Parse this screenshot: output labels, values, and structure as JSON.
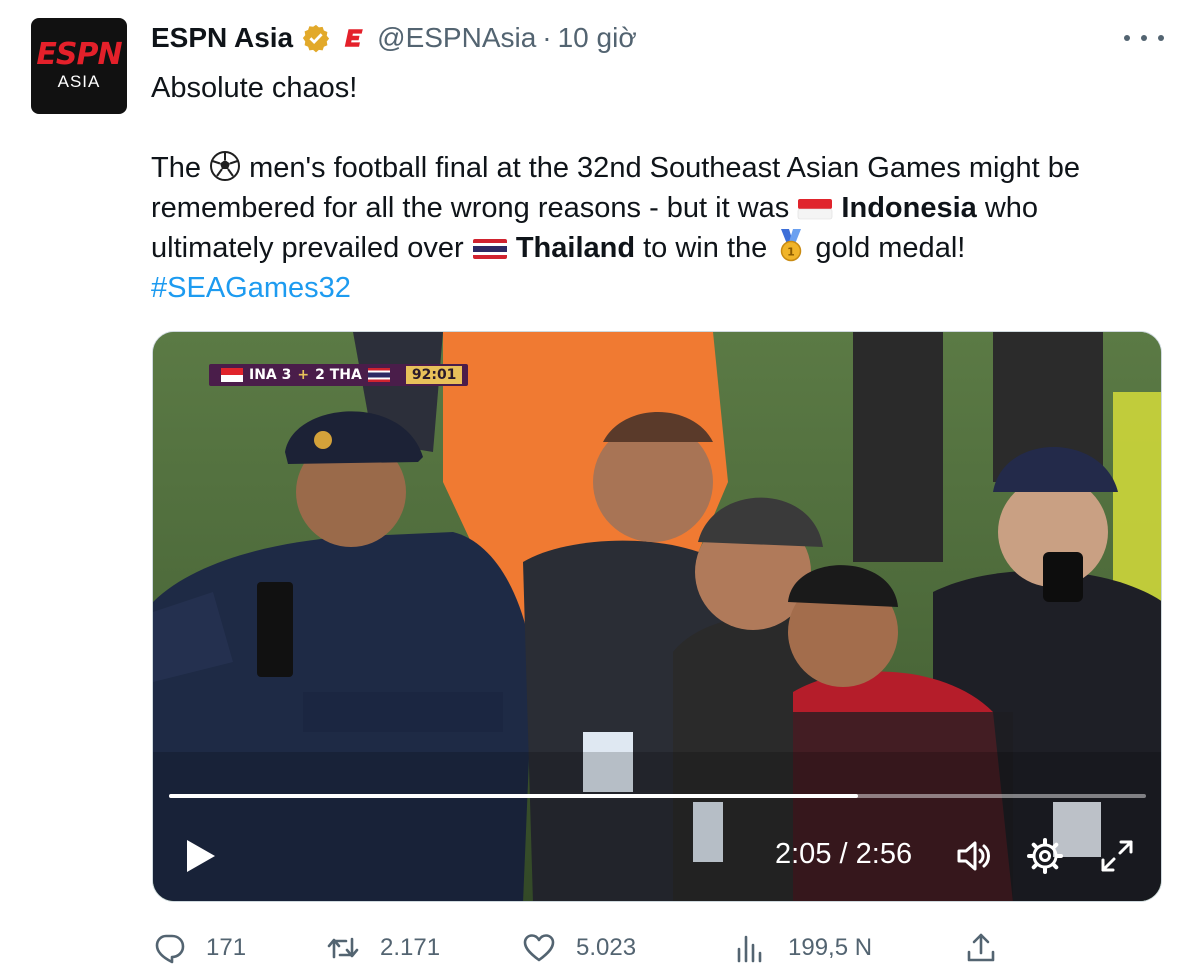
{
  "author": {
    "avatar_brand": "ESPN",
    "avatar_sub": "ASIA",
    "name": "ESPN Asia",
    "handle": "@ESPNAsia",
    "time": "10 giờ",
    "verified_color": "#e2a92a",
    "affiliate_icon": "espn-e-icon"
  },
  "tweet": {
    "line1": "Absolute chaos!",
    "p2_a": "The",
    "p2_b": "men's football final at the 32nd Southeast Asian Games might be remembered for all the wrong reasons - but it was",
    "country1": "Indonesia",
    "p2_c": "who ultimately prevailed over",
    "country2": "Thailand",
    "p2_d": "to win the",
    "p2_e": "gold medal!",
    "hashtag": "#SEAGames32",
    "emojis": [
      "soccer-ball",
      "indonesia-flag",
      "thailand-flag",
      "gold-medal"
    ]
  },
  "video": {
    "scorebug": {
      "team1": "INA",
      "score1": "3",
      "score2": "2",
      "team2": "THA",
      "clock": "92:01"
    },
    "progress": 0.705,
    "current_time": "2:05",
    "duration": "2:56",
    "separator": "/",
    "controls": [
      "play-icon",
      "volume-icon",
      "settings-icon",
      "fullscreen-icon"
    ]
  },
  "actions": {
    "replies": "171",
    "retweets": "2.171",
    "likes": "5.023",
    "views": "199,5 N",
    "icons": [
      "reply-icon",
      "retweet-icon",
      "like-icon",
      "views-icon",
      "share-icon"
    ]
  },
  "colors": {
    "accent": "#1d9bf0",
    "muted": "#536471",
    "espn_red": "#e4202a"
  }
}
